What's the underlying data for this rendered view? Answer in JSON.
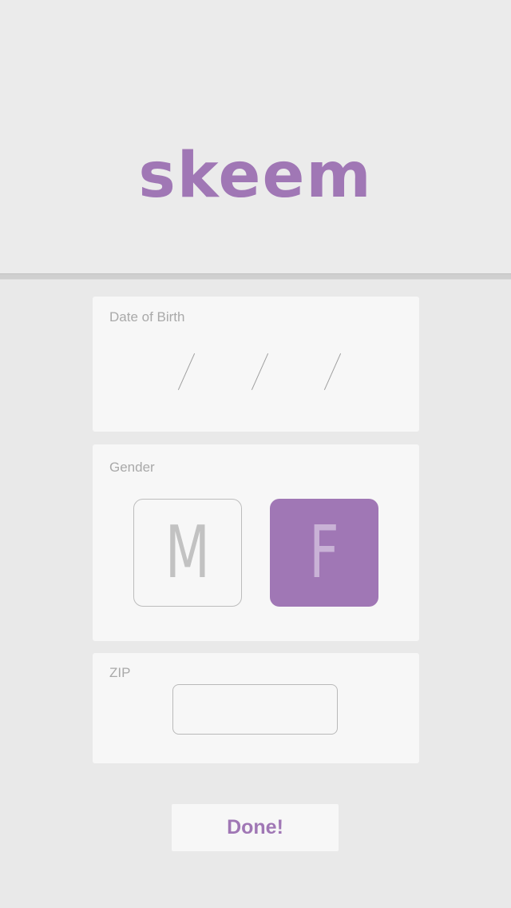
{
  "app": {
    "logo_text": "skeem"
  },
  "colors": {
    "brand": "#a077b5",
    "card_bg": "#f7f7f7",
    "label": "#a9a9a9"
  },
  "dob": {
    "label": "Date of Birth",
    "separators": [
      "/",
      "/",
      "/"
    ]
  },
  "gender": {
    "label": "Gender",
    "options": [
      {
        "label": "M",
        "selected": false
      },
      {
        "label": "F",
        "selected": true
      }
    ]
  },
  "zip": {
    "label": "ZIP",
    "value": "",
    "placeholder": ""
  },
  "actions": {
    "done_label": "Done!"
  }
}
